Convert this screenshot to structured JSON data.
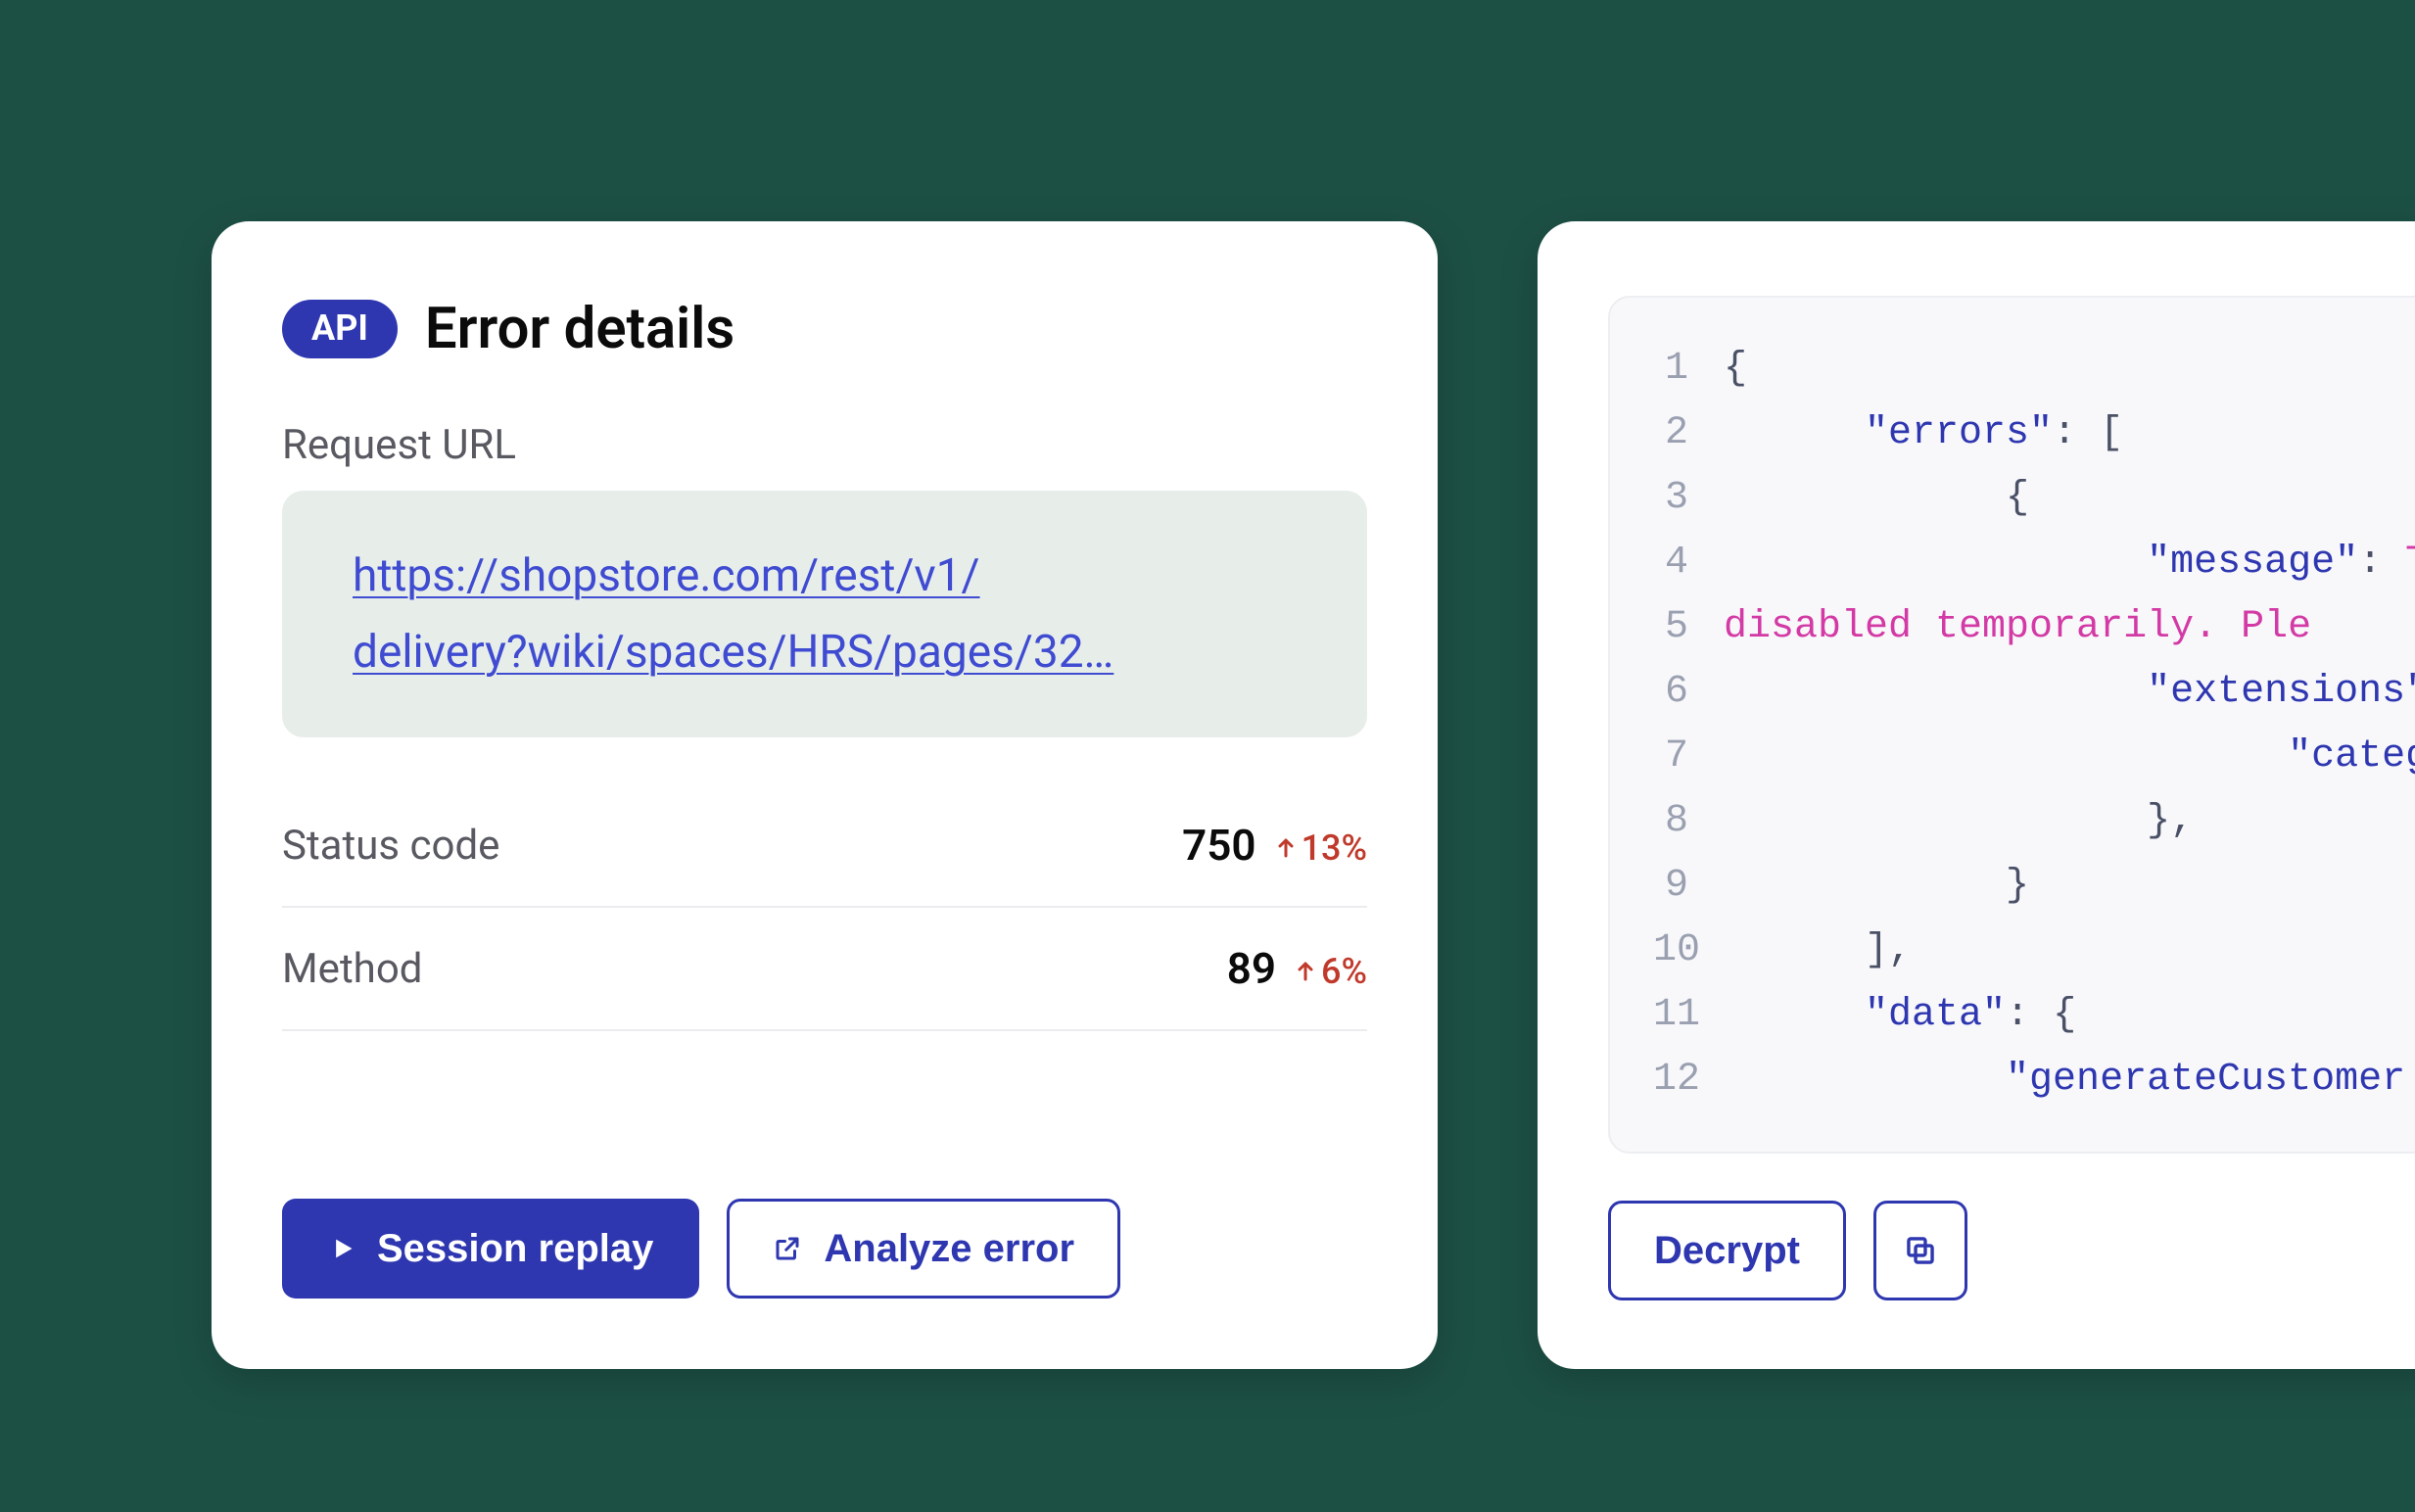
{
  "left": {
    "badge": "API",
    "title": "Error details",
    "request_url_label": "Request URL",
    "request_url_line1": "https://shopstore.com/rest/v1/",
    "request_url_line2": "delivery?wiki/spaces/HRS/pages/32…",
    "stats": {
      "status_code": {
        "label": "Status code",
        "value": "750",
        "delta": "13%"
      },
      "method": {
        "label": "Method",
        "value": "89",
        "delta": "6%"
      }
    },
    "buttons": {
      "session_replay": "Session replay",
      "analyze_error": "Analyze error"
    }
  },
  "right": {
    "code": {
      "lines": [
        {
          "n": "1",
          "indent": 0,
          "segs": [
            {
              "t": "{",
              "c": "punc"
            }
          ]
        },
        {
          "n": "2",
          "indent": 1,
          "segs": [
            {
              "t": "\"errors\"",
              "c": "key"
            },
            {
              "t": ": [",
              "c": "punc"
            }
          ]
        },
        {
          "n": "3",
          "indent": 2,
          "segs": [
            {
              "t": "{",
              "c": "punc"
            }
          ]
        },
        {
          "n": "4",
          "indent": 3,
          "segs": [
            {
              "t": "\"message\"",
              "c": "key"
            },
            {
              "t": ": ",
              "c": "punc"
            },
            {
              "t": "Th",
              "c": "str"
            }
          ]
        },
        {
          "n": "5",
          "indent": 0,
          "segs": [
            {
              "t": "disabled temporarily. Ple",
              "c": "str"
            }
          ]
        },
        {
          "n": "6",
          "indent": 3,
          "segs": [
            {
              "t": "\"extensions\"",
              "c": "key"
            },
            {
              "t": ":",
              "c": "punc"
            }
          ]
        },
        {
          "n": "7",
          "indent": 4,
          "segs": [
            {
              "t": "\"category",
              "c": "key"
            }
          ]
        },
        {
          "n": "8",
          "indent": 3,
          "segs": [
            {
              "t": "},",
              "c": "punc"
            }
          ]
        },
        {
          "n": "9",
          "indent": 2,
          "segs": [
            {
              "t": "}",
              "c": "punc"
            }
          ]
        },
        {
          "n": "10",
          "indent": 1,
          "segs": [
            {
              "t": "],",
              "c": "punc"
            }
          ]
        },
        {
          "n": "11",
          "indent": 1,
          "segs": [
            {
              "t": "\"data\"",
              "c": "key"
            },
            {
              "t": ": {",
              "c": "punc"
            }
          ]
        },
        {
          "n": "12",
          "indent": 2,
          "segs": [
            {
              "t": "\"generateCustomer",
              "c": "key"
            }
          ]
        }
      ]
    },
    "buttons": {
      "decrypt": "Decrypt"
    }
  }
}
